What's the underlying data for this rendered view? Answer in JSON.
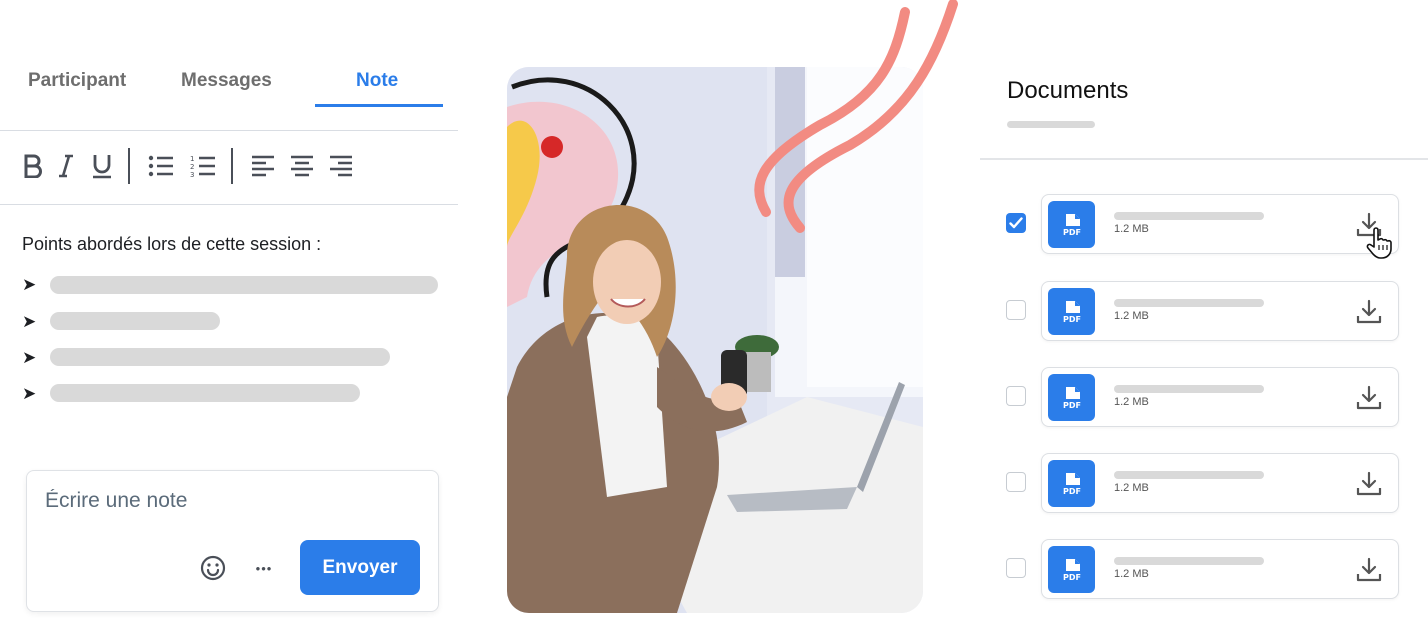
{
  "tabs": [
    {
      "label": "Participant"
    },
    {
      "label": "Messages"
    },
    {
      "label": "Note"
    }
  ],
  "active_tab": "Note",
  "toolbar": {
    "icons": [
      "bold-icon",
      "italic-icon",
      "underline-icon",
      "bullet-list-icon",
      "numbered-list-icon",
      "align-left-icon",
      "align-center-icon",
      "align-right-icon"
    ]
  },
  "note": {
    "heading": "Points abordés lors de cette session :",
    "bullet_symbol": "➤"
  },
  "composer": {
    "placeholder": "Écrire une note",
    "send_label": "Envoyer",
    "more_symbol": "•••"
  },
  "documents": {
    "title": "Documents",
    "items": [
      {
        "size": "1.2 MB",
        "checked": true
      },
      {
        "size": "1.2 MB",
        "checked": false
      },
      {
        "size": "1.2 MB",
        "checked": false
      },
      {
        "size": "1.2 MB",
        "checked": false
      },
      {
        "size": "1.2 MB",
        "checked": false
      }
    ],
    "pdf_label": "PDF"
  },
  "colors": {
    "accent": "#2b7de9",
    "squiggle": "#f28b82",
    "skeleton": "#d9d9d9"
  }
}
